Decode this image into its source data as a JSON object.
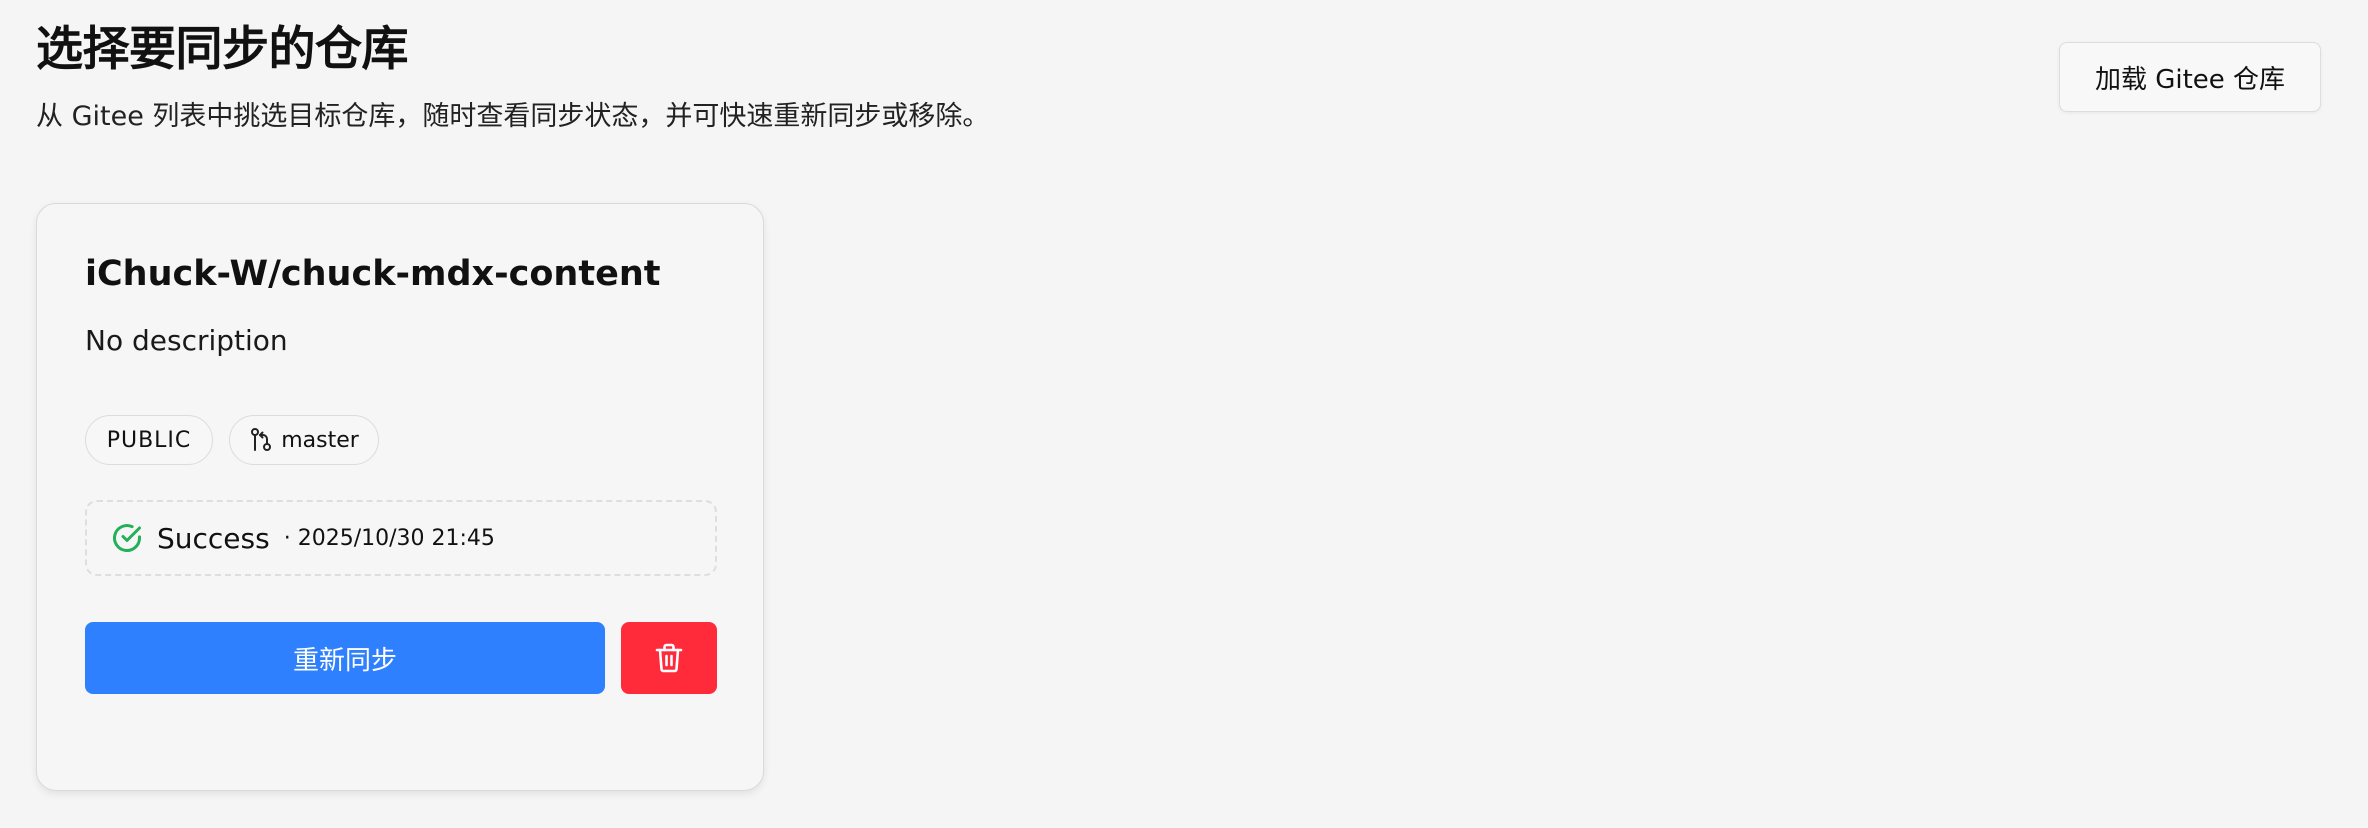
{
  "header": {
    "title": "选择要同步的仓库",
    "subtitle": "从 Gitee 列表中挑选目标仓库，随时查看同步状态，并可快速重新同步或移除。",
    "load_button_label": "加载 Gitee 仓库"
  },
  "repositories": [
    {
      "name": "iChuck-W/chuck-mdx-content",
      "description": "No description",
      "visibility": "PUBLIC",
      "branch": "master",
      "branch_icon": "git-branch-icon",
      "sync": {
        "status": "Success",
        "status_icon": "check-circle-icon",
        "status_color": "#22b05a",
        "time": "· 2025/10/30 21:45"
      },
      "resync_label": "重新同步",
      "delete_icon": "trash-icon"
    }
  ],
  "colors": {
    "background": "#f5f5f5",
    "primary": "#2f80ff",
    "danger": "#ff2b3b",
    "success": "#22b05a"
  }
}
